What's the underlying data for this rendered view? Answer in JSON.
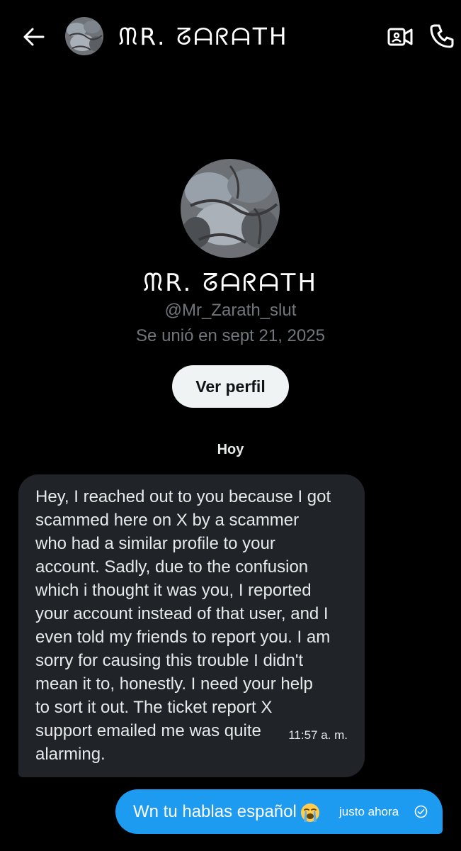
{
  "header": {
    "contact_name": "ᙏR. ᘔᗩᖇᗩTᕼ"
  },
  "profile": {
    "display_name": "ᙏR. ᘔᗩᖇᗩTᕼ",
    "handle": "@Mr_Zarath_slut",
    "joined": "Se unió en sept 21, 2025",
    "view_profile_label": "Ver perfil"
  },
  "conversation": {
    "date_separator": "Hoy",
    "messages": [
      {
        "direction": "received",
        "text": "Hey, I reached out to you because I got\nscammed here on X by a scammer\nwho had a similar profile to your\naccount. Sadly, due to the confusion\nwhich i thought it was you, I reported\nyour account instead of that user, and I\neven told my friends to report you. I am\nsorry for causing this trouble I didn't\nmean it to, honestly. I need your help\nto sort it out. The ticket report X\nsupport emailed me was quite\nalarming.",
        "time": "11:57 a. m."
      },
      {
        "direction": "sent",
        "text": "Wn tu hablas español",
        "emoji": "loudly-crying-face",
        "time": "justo ahora",
        "status_icon": "sent-check-icon"
      }
    ]
  },
  "icons": {
    "back": "back-arrow-icon",
    "video": "video-call-icon",
    "phone": "phone-call-icon"
  },
  "colors": {
    "background": "#000000",
    "received_bubble": "#202327",
    "sent_bubble": "#1d9bf0",
    "secondary_text": "#71767b",
    "button_bg": "#eff3f4"
  }
}
